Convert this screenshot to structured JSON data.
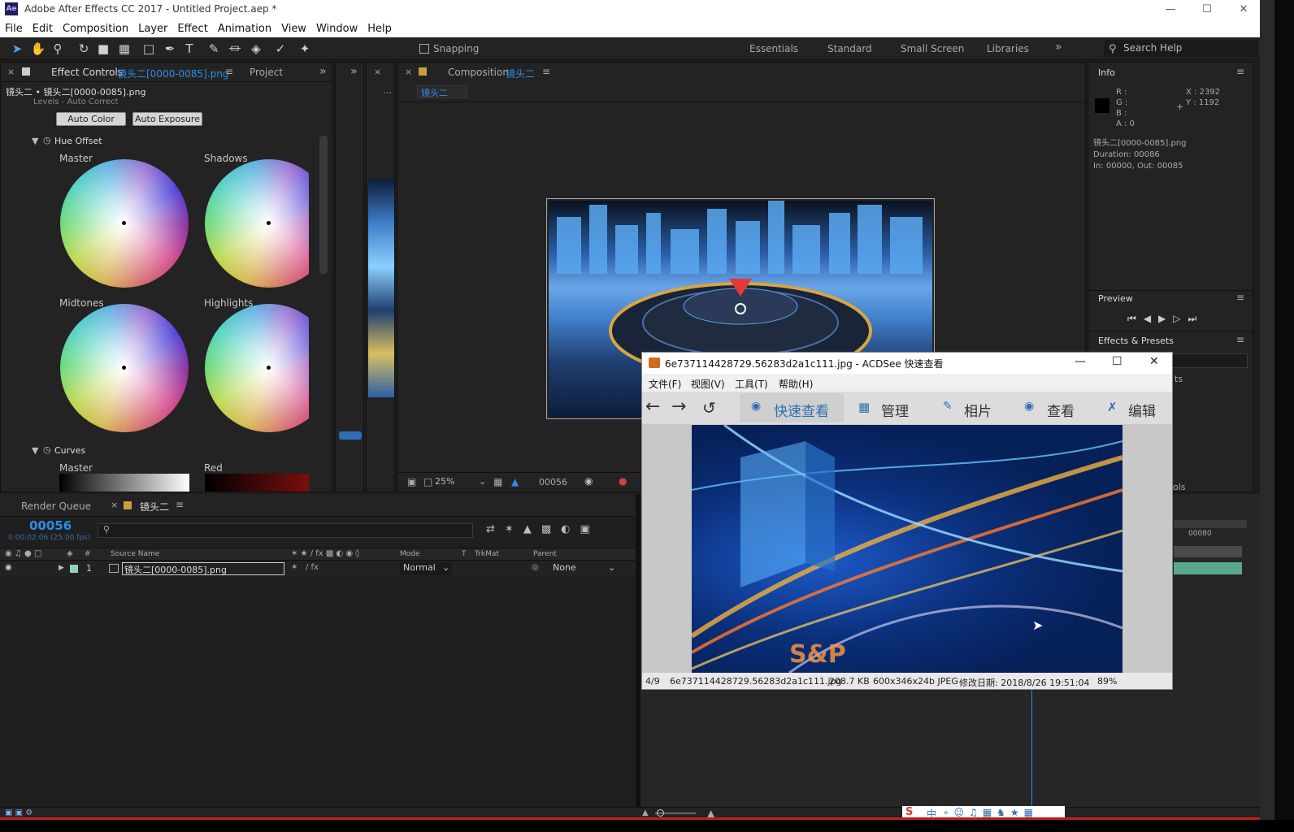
{
  "window": {
    "title": "Adobe After Effects CC 2017 - Untitled Project.aep *",
    "app_icon": "Ae"
  },
  "menu": [
    "File",
    "Edit",
    "Composition",
    "Layer",
    "Effect",
    "Animation",
    "View",
    "Window",
    "Help"
  ],
  "toolbar": {
    "snapping_label": "Snapping",
    "workspaces": [
      "Essentials",
      "Standard",
      "Small Screen",
      "Libraries"
    ],
    "search_placeholder": "Search Help"
  },
  "effect_controls": {
    "tab_label": "Effect Controls",
    "tab_layer": "镜头二[0000-0085].png",
    "project_tab": "Project",
    "breadcrumb": "镜头二 • 镜头二[0000-0085].png",
    "levels_label": "Levels - Auto Correct",
    "auto_color": "Auto Color",
    "auto_exposure": "Auto Exposure",
    "hue_offset": "Hue Offset",
    "wheels": [
      "Master",
      "Shadows",
      "Midtones",
      "Highlights"
    ],
    "curves": "Curves",
    "curves_channels": [
      "Master",
      "Red"
    ]
  },
  "composition": {
    "tab_label": "Composition",
    "comp_name": "镜头二",
    "sub_tab": "镜头二",
    "zoom": "25%",
    "timecode": "00056"
  },
  "info": {
    "title": "Info",
    "r": "R :",
    "g": "G :",
    "b": "B :",
    "a": "A : 0",
    "x": "X : 2392",
    "y": "Y : 1192",
    "file": "镜头二[0000-0085].png",
    "duration": "Duration: 00086",
    "inout": "In: 00000, Out: 00085",
    "preview_title": "Preview",
    "effects_title": "Effects & Presets",
    "effects_partial_1": "ts",
    "effects_partial_2": "ols"
  },
  "timeline": {
    "render_queue": "Render Queue",
    "comp_tab": "镜头二",
    "timecode": "00056",
    "timecode_sub": "0:00:02:06 (25.00 fps)",
    "columns": {
      "num": "#",
      "source": "Source Name",
      "mode": "Mode",
      "t": "T",
      "trkmat": "TrkMat",
      "parent": "Parent"
    },
    "layer": {
      "num": "1",
      "name": "镜头二[0000-0085].png",
      "mode": "Normal",
      "parent": "None"
    },
    "ruler_mark": "00080"
  },
  "acdsee": {
    "title": "6e737114428729.56283d2a1c111.jpg - ACDSee 快速查看",
    "menu": [
      "文件(F)",
      "视图(V)",
      "工具(T)",
      "帮助(H)"
    ],
    "tabs": [
      "快速查看",
      "管理",
      "相片",
      "查看",
      "编辑"
    ],
    "status": {
      "index": "4/9",
      "filename": "6e737114428729.56283d2a1c111.jpg",
      "size": "208.7 KB",
      "dims": "600x346x24b JPEG",
      "modified": "修改日期:  2018/8/26 19:51:04",
      "zoom": "89%"
    },
    "photo_text": "S&P"
  },
  "ime": {
    "brand": "S",
    "lang": "中"
  }
}
